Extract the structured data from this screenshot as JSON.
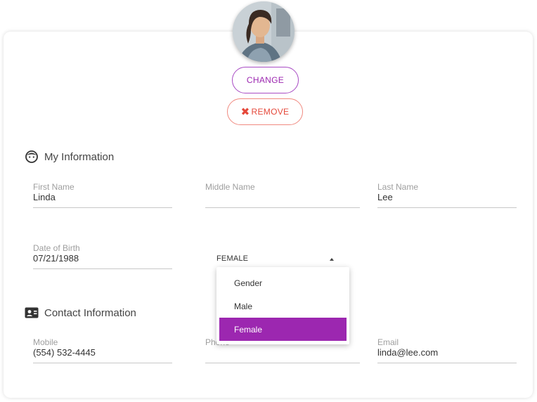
{
  "profile": {
    "change_label": "CHANGE",
    "remove_label": "REMOVE"
  },
  "my_info": {
    "title": "My Information",
    "first_name": {
      "label": "First Name",
      "value": "Linda"
    },
    "middle_name": {
      "label": "Middle Name",
      "value": ""
    },
    "last_name": {
      "label": "Last Name",
      "value": "Lee"
    },
    "dob": {
      "label": "Date of Birth",
      "value": "07/21/1988"
    },
    "gender": {
      "value": "FEMALE",
      "options": [
        "Gender",
        "Male",
        "Female"
      ],
      "selected": "Female"
    }
  },
  "contact": {
    "title": "Contact Information",
    "mobile": {
      "label": "Mobile",
      "value": "(554) 532-4445"
    },
    "phone": {
      "label": "Phone",
      "value": ""
    },
    "email": {
      "label": "Email",
      "value": "linda@lee.com"
    }
  },
  "colors": {
    "accent": "#9c27b0",
    "remove": "#e5483a"
  }
}
